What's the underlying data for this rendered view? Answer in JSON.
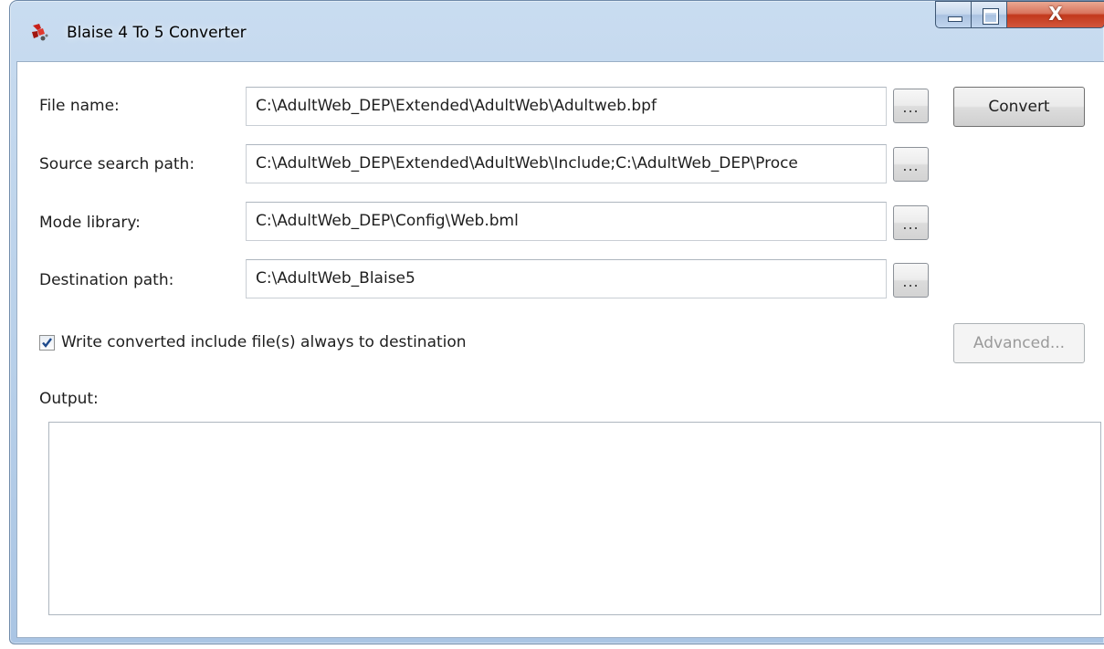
{
  "window": {
    "title": "Blaise 4 To 5 Converter",
    "icon": "blaise-app-icon",
    "minimize_icon": "minimize-icon",
    "maximize_icon": "maximize-icon",
    "close_glyph": "X"
  },
  "form": {
    "file_name": {
      "label": "File name:",
      "value": "C:\\AdultWeb_DEP\\Extended\\AdultWeb\\Adultweb.bpf"
    },
    "source_search_path": {
      "label": "Source search path:",
      "value": "C:\\AdultWeb_DEP\\Extended\\AdultWeb\\Include;C:\\AdultWeb_DEP\\Proce"
    },
    "mode_library": {
      "label": "Mode library:",
      "value": "C:\\AdultWeb_DEP\\Config\\Web.bml"
    },
    "destination_path": {
      "label": "Destination path:",
      "value": "C:\\AdultWeb_Blaise5"
    },
    "browse_label": "...",
    "write_include_checkbox": {
      "label": "Write converted include file(s) always to destination",
      "checked": true
    },
    "output_label": "Output:",
    "output_text": ""
  },
  "buttons": {
    "convert_label": "Convert",
    "advanced_label": "Advanced..."
  },
  "colors": {
    "titlebar": "#b7cfe9",
    "close_button": "#c2381c",
    "checkmark": "#1e4a8c",
    "disabled_text": "#9a9a9a"
  }
}
